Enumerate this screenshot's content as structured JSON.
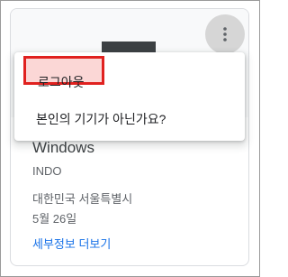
{
  "menu": {
    "items": [
      {
        "label": "로그아웃",
        "highlighted": true
      },
      {
        "label": "본인의 기기가 아닌가요?"
      }
    ],
    "highlight_color": "#e0211f"
  },
  "device": {
    "name": "Windows",
    "subtitle": "INDO",
    "location": "대한민국 서울특별시",
    "date": "5월 26일",
    "details_link": "세부정보 더보기"
  },
  "icons": {
    "more": "more-vert-icon"
  },
  "colors": {
    "link": "#1a73e8",
    "more_button_bg": "#d6d6d6"
  }
}
